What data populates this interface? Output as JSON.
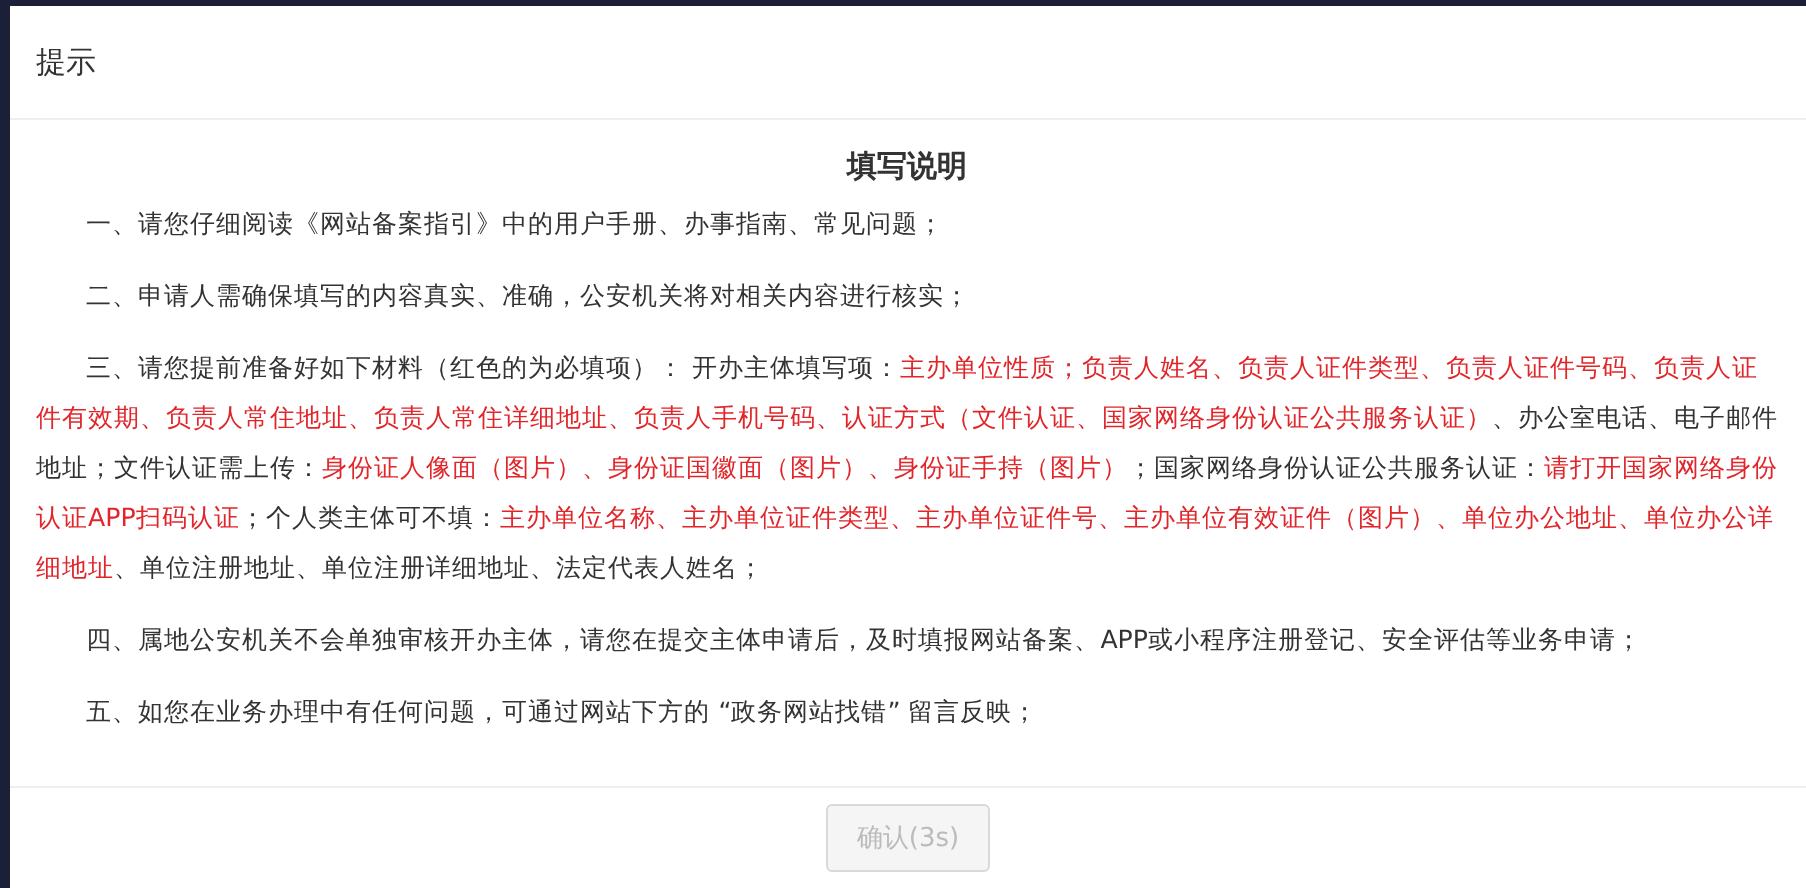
{
  "dialog": {
    "title": "提示",
    "heading": "填写说明",
    "paragraphs": [
      {
        "segments": [
          {
            "text": "一、请您仔细阅读《网站备案指引》中的用户手册、办事指南、常见问题；",
            "required": false
          }
        ]
      },
      {
        "segments": [
          {
            "text": "二、申请人需确保填写的内容真实、准确，公安机关将对相关内容进行核实；",
            "required": false
          }
        ]
      },
      {
        "segments": [
          {
            "text": "三、请您提前准备好如下材料（红色的为必填项）： 开办主体填写项：",
            "required": false
          },
          {
            "text": "主办单位性质；负责人姓名、负责人证件类型、负责人证件号码、负责人证件有效期、负责人常住地址、负责人常住详细地址、负责人手机号码、认证方式（文件认证、国家网络身份认证公共服务认证）",
            "required": true
          },
          {
            "text": "、办公室电话、电子邮件地址；文件认证需上传：",
            "required": false
          },
          {
            "text": "身份证人像面（图片）、身份证国徽面（图片）、身份证手持（图片）",
            "required": true
          },
          {
            "text": "；国家网络身份认证公共服务认证：",
            "required": false
          },
          {
            "text": "请打开国家网络身份认证APP扫码认证",
            "required": true
          },
          {
            "text": "；个人类主体可不填：",
            "required": false
          },
          {
            "text": "主办单位名称、主办单位证件类型、主办单位证件号、主办单位有效证件（图片）、单位办公地址、单位办公详细地址",
            "required": true
          },
          {
            "text": "、单位注册地址、单位注册详细地址、法定代表人姓名；",
            "required": false
          }
        ]
      },
      {
        "segments": [
          {
            "text": "四、属地公安机关不会单独审核开办主体，请您在提交主体申请后，及时填报网站备案、APP或小程序注册登记、安全评估等业务申请；",
            "required": false
          }
        ]
      },
      {
        "segments": [
          {
            "text": "五、如您在业务办理中有任何问题，可通过网站下方的 “政务网站找错” 留言反映；",
            "required": false
          }
        ]
      }
    ],
    "confirm_button": {
      "label": "确认(3s)",
      "disabled": true
    }
  }
}
